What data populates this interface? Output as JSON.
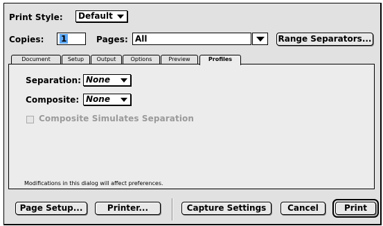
{
  "header": {
    "print_style_label": "Print Style:",
    "print_style_value": "Default",
    "copies_label": "Copies:",
    "copies_value": "1",
    "pages_label": "Pages:",
    "pages_value": "All",
    "range_separators_button": "Range Separators..."
  },
  "tabs": [
    {
      "label": "Document"
    },
    {
      "label": "Setup"
    },
    {
      "label": "Output"
    },
    {
      "label": "Options"
    },
    {
      "label": "Preview"
    },
    {
      "label": "Profiles",
      "active": true
    }
  ],
  "profiles": {
    "separation_label": "Separation:",
    "separation_value": "None",
    "composite_label": "Composite:",
    "composite_value": "None",
    "composite_sim_label": "Composite Simulates Separation",
    "composite_sim_checked": false,
    "composite_sim_enabled": false,
    "note": "Modifications in this dialog will affect preferences."
  },
  "footer": {
    "page_setup_button": "Page Setup...",
    "printer_button": "Printer...",
    "capture_settings_button": "Capture Settings",
    "cancel_button": "Cancel",
    "print_button": "Print"
  },
  "colors": {
    "dialog_bg": "#e1e1e1",
    "panel_bg": "#ececec",
    "copies_selection": "#5fa8f5",
    "disabled_text": "#9a9a9a"
  },
  "icons": {
    "popup_arrow": "triangle-down-icon"
  }
}
